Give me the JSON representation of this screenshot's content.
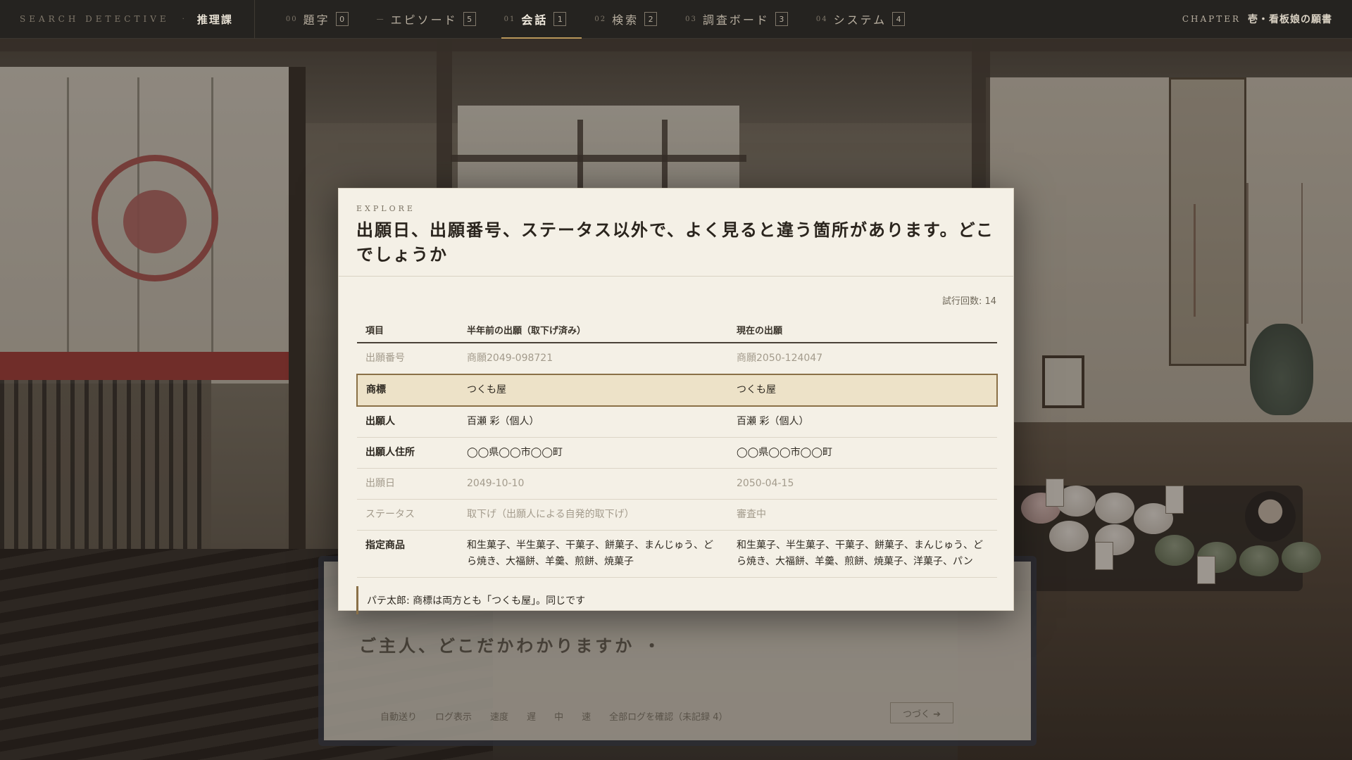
{
  "topbar": {
    "brand_en": "SEARCH DETECTIVE",
    "brand_dot": "·",
    "brand_jp": "推理課",
    "nav": [
      {
        "num": "00",
        "label": "題字",
        "key": "0",
        "active": false
      },
      {
        "num": "—",
        "label": "エピソード",
        "key": "5",
        "active": false
      },
      {
        "num": "01",
        "label": "会話",
        "key": "1",
        "active": true
      },
      {
        "num": "02",
        "label": "検索",
        "key": "2",
        "active": false
      },
      {
        "num": "03",
        "label": "調査ボード",
        "key": "3",
        "active": false
      },
      {
        "num": "04",
        "label": "システム",
        "key": "4",
        "active": false
      }
    ],
    "chapter_en": "CHAPTER",
    "chapter_jp": "壱・看板娘の願書"
  },
  "background_dialog": {
    "line": "ご主人、どこだかわかりますか ・",
    "controls": [
      "自動送り",
      "ログ表示",
      "速度",
      "遅",
      "中",
      "速",
      "全部ログを確認（未記録 4）"
    ],
    "next_label": "つづく ➔"
  },
  "modal": {
    "eyebrow": "EXPLORE",
    "question": "出願日、出願番号、ステータス以外で、よく見ると違う箇所があります。どこでしょうか",
    "attempts": "試行回数: 14",
    "table": {
      "headers": [
        "項目",
        "半年前の出願（取下げ済み）",
        "現在の出願"
      ],
      "rows": [
        {
          "item": "出願番号",
          "old": "商願2049-098721",
          "new": "商願2050-124047",
          "state": "dim"
        },
        {
          "item": "商標",
          "old": "つくも屋",
          "new": "つくも屋",
          "state": "highlight"
        },
        {
          "item": "出願人",
          "old": "百瀬 彩（個人）",
          "new": "百瀬 彩（個人）",
          "state": "normal"
        },
        {
          "item": "出願人住所",
          "old": "◯◯県◯◯市◯◯町",
          "new": "◯◯県◯◯市◯◯町",
          "state": "normal"
        },
        {
          "item": "出願日",
          "old": "2049-10-10",
          "new": "2050-04-15",
          "state": "dim"
        },
        {
          "item": "ステータス",
          "old": "取下げ（出願人による自発的取下げ）",
          "new": "審査中",
          "state": "dim"
        },
        {
          "item": "指定商品",
          "old": "和生菓子、半生菓子、干菓子、餅菓子、まんじゅう、どら焼き、大福餅、羊羹、煎餅、焼菓子",
          "new": "和生菓子、半生菓子、干菓子、餅菓子、まんじゅう、どら焼き、大福餅、羊羹、煎餅、焼菓子、洋菓子、パン",
          "state": "normal"
        }
      ]
    },
    "hint": "パテ太郎: 商標は両方とも「つくも屋」。同じです"
  },
  "colors": {
    "accent_gold": "#b8965a",
    "highlight_row": "#ede2c8",
    "highlight_border": "#8a7047",
    "modal_bg": "#f4f0e6",
    "topbar_bg": "#252320"
  }
}
